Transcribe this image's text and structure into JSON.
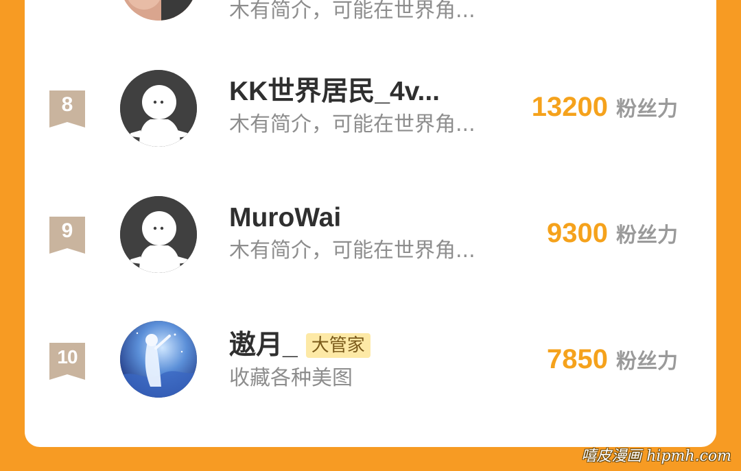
{
  "list": {
    "partial_top": {
      "desc": "木有简介，可能在世界角..."
    },
    "rows": [
      {
        "rank": "8",
        "name": "KK世界居民_4v...",
        "badge": "",
        "desc": "木有简介，可能在世界角...",
        "fans": "13200",
        "unit": "粉丝力",
        "avatar": "default-person-icon"
      },
      {
        "rank": "9",
        "name": "MuroWai",
        "badge": "",
        "desc": "木有简介，可能在世界角...",
        "fans": "9300",
        "unit": "粉丝力",
        "avatar": "default-person-icon"
      },
      {
        "rank": "10",
        "name": "遨月_",
        "badge": "大管家",
        "desc": "收藏各种美图",
        "fans": "7850",
        "unit": "粉丝力",
        "avatar": "anime-girl-avatar"
      }
    ]
  },
  "watermark": "嘻皮漫画 hipmh.com",
  "colors": {
    "frame_orange": "#f79b23",
    "fans_number": "#f5a21c",
    "rank_ribbon": "#c9b49e",
    "badge_bg": "#fde9a6"
  }
}
